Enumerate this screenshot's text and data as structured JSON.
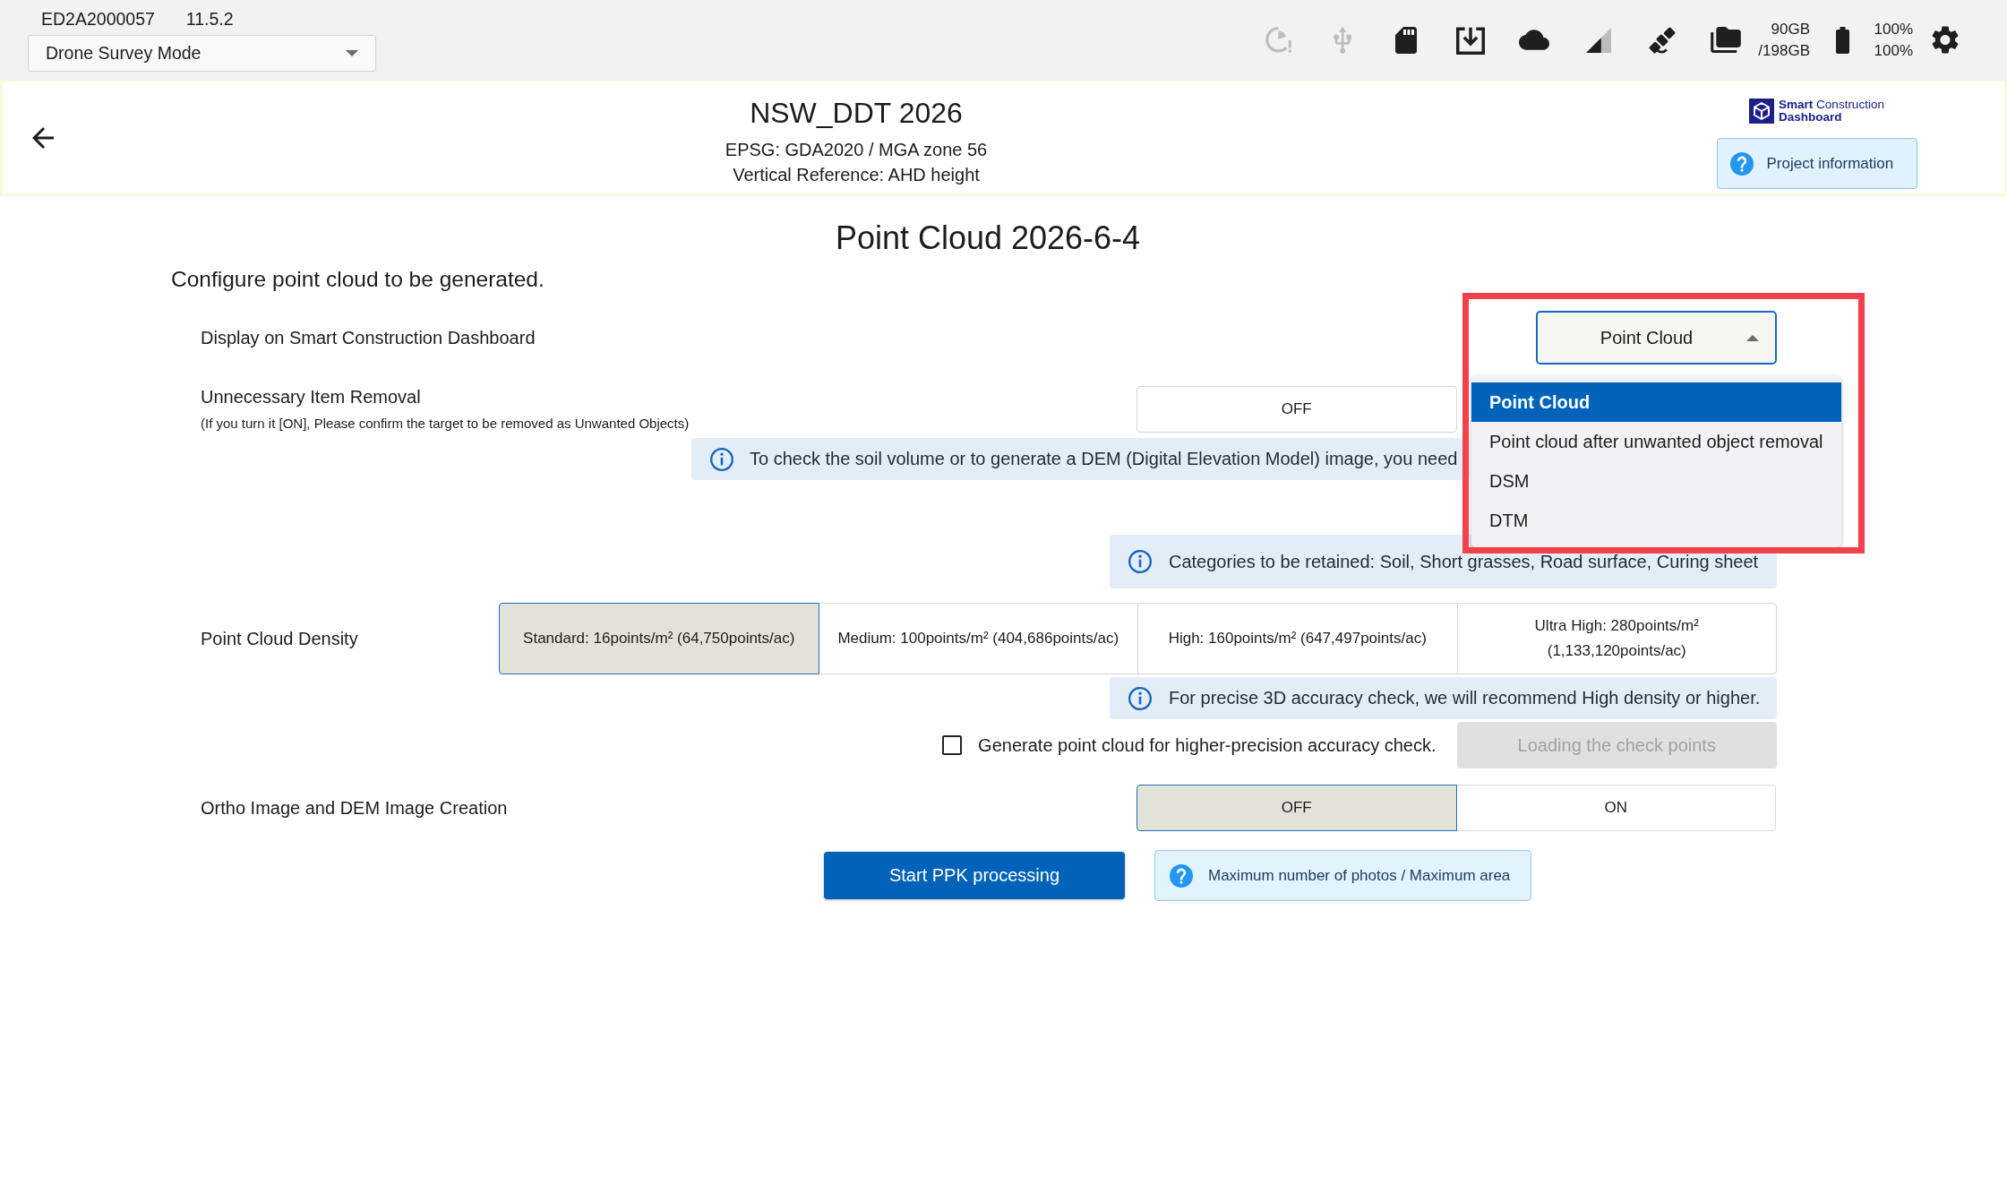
{
  "top_bar": {
    "device_id": "ED2A2000057",
    "version": "11.5.2",
    "mode_select": {
      "value": "Drone Survey Mode"
    },
    "status_icons": [
      {
        "active": false
      },
      {
        "active": false
      },
      {
        "active": true
      },
      {
        "active": true
      },
      {
        "active": true
      },
      {
        "active": true
      },
      {
        "active": true
      },
      {
        "active": true
      }
    ],
    "storage": {
      "used": "90GB",
      "total": "/198GB"
    },
    "battery_readings": [
      "100%",
      "100%"
    ]
  },
  "header": {
    "title": "NSW_DDT 2026",
    "coordinate_system": "EPSG: GDA2020 / MGA zone 56",
    "vertical_reference": "Vertical Reference: AHD height",
    "logo": {
      "line_1": "**Smart** Construction",
      "line_2": "Dashboard"
    },
    "project_info_button": "Project information"
  },
  "page": {
    "title": "Point Cloud 2026-6-4",
    "intro": "Configure point cloud to be generated."
  },
  "settings": [
    {
      "kind": "select",
      "label": "Display on Smart Construction Dashboard",
      "value": "Point Cloud",
      "expanded": true,
      "highlighted": true,
      "options": [
        {
          "label": "Point Cloud",
          "selected": true
        },
        {
          "label": "Point cloud after unwanted object removal",
          "selected": false
        },
        {
          "label": "DSM",
          "selected": false
        },
        {
          "label": "DTM",
          "selected": false
        }
      ]
    },
    {
      "kind": "toggle",
      "label": "Unnecessary Item Removal",
      "note": "(If you turn it [ON], Please confirm the target to be removed as Unwanted Objects)",
      "options": [
        {
          "label": "OFF",
          "selected": false
        }
      ]
    },
    {
      "kind": "wide_notice",
      "text": "To check the soil volume or to generate a DEM (Digital Elevation Model) image, you need"
    },
    {
      "kind": "notice",
      "text": "Categories to be retained: Soil, Short grasses, Road surface, Curing sheet"
    },
    {
      "kind": "toggle",
      "label": "Point Cloud Density",
      "options": [
        {
          "label": "Standard: 16points/m² (64,750points/ac)",
          "selected": true
        },
        {
          "label": "Medium: 100points/m² (404,686points/ac)",
          "selected": false
        },
        {
          "label": "High: 160points/m² (647,497points/ac)",
          "selected": false
        },
        {
          "label": "Ultra High: 280points/m² (1,133,120points/ac)",
          "selected": false
        }
      ]
    },
    {
      "kind": "notice",
      "text": "For precise 3D accuracy check, we will recommend High density or higher."
    },
    {
      "kind": "checkbox",
      "label": "Generate point cloud for higher-precision accuracy check.",
      "checked": false,
      "button": {
        "label": "Loading the check points",
        "disabled": true
      }
    },
    {
      "kind": "toggle",
      "label": "Ortho Image and DEM Image Creation",
      "options": [
        {
          "label": "OFF",
          "selected": true
        },
        {
          "label": "ON",
          "selected": false
        }
      ]
    }
  ],
  "actions": {
    "start_button": "Start PPK processing",
    "help_button": "Maximum number of photos / Maximum area"
  }
}
